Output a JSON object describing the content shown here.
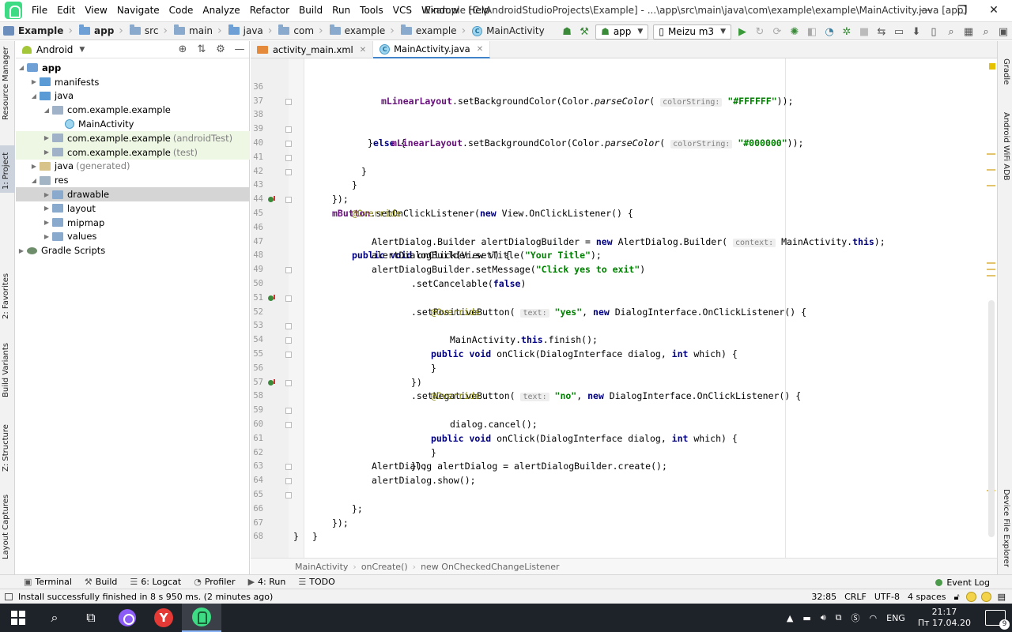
{
  "window": {
    "title": "Example [C:\\AndroidStudioProjects\\Example] - ...\\app\\src\\main\\java\\com\\example\\example\\MainActivity.java [app]",
    "menu": [
      "File",
      "Edit",
      "View",
      "Navigate",
      "Code",
      "Analyze",
      "Refactor",
      "Build",
      "Run",
      "Tools",
      "VCS",
      "Window",
      "Help"
    ],
    "minimize": "—",
    "restore": "❐",
    "close": "✕"
  },
  "navbar": {
    "crumbs": [
      "Example",
      "app",
      "src",
      "main",
      "java",
      "com",
      "example",
      "example",
      "MainActivity"
    ],
    "run_config": "app",
    "device": "Meizu m3"
  },
  "left_tools": [
    "Resource Manager",
    "1: Project",
    "2: Favorites",
    "Build Variants",
    "Z: Structure",
    "Layout Captures"
  ],
  "right_tools": [
    "Gradle",
    "Android WiFi ADB",
    "Device File Explorer"
  ],
  "project_panel": {
    "view_mode": "Android",
    "tree": [
      {
        "label": "app",
        "muted": "",
        "depth": 0
      },
      {
        "label": "manifests",
        "muted": "",
        "depth": 1
      },
      {
        "label": "java",
        "muted": "",
        "depth": 1
      },
      {
        "label": "com.example.example",
        "muted": "",
        "depth": 2
      },
      {
        "label": "MainActivity",
        "muted": "",
        "depth": 3
      },
      {
        "label": "com.example.example",
        "muted": "(androidTest)",
        "depth": 2
      },
      {
        "label": "com.example.example",
        "muted": "(test)",
        "depth": 2
      },
      {
        "label": "java",
        "muted": "(generated)",
        "depth": 1
      },
      {
        "label": "res",
        "muted": "",
        "depth": 1
      },
      {
        "label": "drawable",
        "muted": "",
        "depth": 2
      },
      {
        "label": "layout",
        "muted": "",
        "depth": 2
      },
      {
        "label": "mipmap",
        "muted": "",
        "depth": 2
      },
      {
        "label": "values",
        "muted": "",
        "depth": 2
      },
      {
        "label": "Gradle Scripts",
        "muted": "",
        "depth": 0
      }
    ]
  },
  "editor": {
    "tabs": [
      {
        "label": "activity_main.xml",
        "active": false
      },
      {
        "label": "MainActivity.java",
        "active": true
      }
    ],
    "line_numbers": [
      "36",
      "37",
      "38",
      "39",
      "40",
      "41",
      "42",
      "43",
      "44",
      "45",
      "46",
      "47",
      "48",
      "49",
      "50",
      "51",
      "52",
      "53",
      "54",
      "55",
      "56",
      "57",
      "58",
      "59",
      "60",
      "61",
      "62",
      "63",
      "64",
      "65",
      "66",
      "67",
      "68"
    ],
    "code": {
      "l36_field": "mLinearLayout",
      "l36_a": ".setBackgroundColor(Color.",
      "l36_method": "parseColor",
      "l36_b": "( ",
      "l36_hint": "colorString:",
      "l36_str": "\"#FFFFFF\"",
      "l36_c": "));",
      "l38_a": "}",
      "l38_kw": "else",
      "l38_b": " {",
      "l39_field": "mLinearLayout",
      "l39_a": ".setBackgroundColor(Color.",
      "l39_method": "parseColor",
      "l39_b": "( ",
      "l39_hint": "colorString:",
      "l39_str": "\"#000000\"",
      "l39_c": "));",
      "l40": "}",
      "l41": "}",
      "l42": "});",
      "l43_field": "mButton",
      "l43_a": ".setOnClickListener(",
      "l43_kw": "new",
      "l43_b": " View.OnClickListener() {",
      "l44_ann": "@Override",
      "l45_kw1": "public",
      "l45_kw2": "void",
      "l45_a": " onClick(View v) {",
      "l46_a": "AlertDialog.Builder alertDialogBuilder = ",
      "l46_kw": "new",
      "l46_b": " AlertDialog.Builder( ",
      "l46_hint": "context:",
      "l46_c": " MainActivity.",
      "l46_kw2": "this",
      "l46_d": ");",
      "l47_a": "alertDialogBuilder.setTitle(",
      "l47_str": "\"Your Title\"",
      "l47_b": ");",
      "l48_a": "alertDialogBuilder.setMessage(",
      "l48_str": "\"Click yes to exit\"",
      "l48_b": ")",
      "l49_a": ".setCancelable(",
      "l49_kw": "false",
      "l49_b": ")",
      "l50_a": ".setPositiveButton( ",
      "l50_hint": "text:",
      "l50_str": "\"yes\"",
      "l50_b": ", ",
      "l50_kw": "new",
      "l50_c": " DialogInterface.OnClickListener() {",
      "l51_ann": "@Override",
      "l52_kw1": "public",
      "l52_kw2": "void",
      "l52_a": " onClick(DialogInterface dialog, ",
      "l52_kw3": "int",
      "l52_b": " which) {",
      "l53_a": "MainActivity.",
      "l53_kw": "this",
      "l53_b": ".finish();",
      "l54": "}",
      "l55": "})",
      "l56_a": ".setNegativeButton( ",
      "l56_hint": "text:",
      "l56_str": "\"no\"",
      "l56_b": ", ",
      "l56_kw": "new",
      "l56_c": " DialogInterface.OnClickListener() {",
      "l57_ann": "@Override",
      "l58_kw1": "public",
      "l58_kw2": "void",
      "l58_a": " onClick(DialogInterface dialog, ",
      "l58_kw3": "int",
      "l58_b": " which) {",
      "l59": "dialog.cancel();",
      "l60": "}",
      "l61": "});",
      "l62": "AlertDialog alertDialog = alertDialogBuilder.create();",
      "l63": "alertDialog.show();",
      "l64": "};",
      "l65": "});",
      "l66": "}",
      "l67": "}"
    },
    "breadcrumb": [
      "MainActivity",
      "onCreate()",
      "new OnCheckedChangeListener"
    ]
  },
  "bottom_tabs": [
    "Terminal",
    "Build",
    "6: Logcat",
    "Profiler",
    "4: Run",
    "TODO"
  ],
  "event_log": "Event Log",
  "status": {
    "message": "Install successfully finished in 8 s 950 ms. (2 minutes ago)",
    "position": "32:85",
    "line_sep": "CRLF",
    "encoding": "UTF-8",
    "indent": "4 spaces"
  },
  "taskbar": {
    "lang": "ENG",
    "time": "21:17",
    "date": "Пт 17.04.20",
    "notifications": "9",
    "yandex_letter": "Y"
  },
  "colors": {
    "keyword": "#000080",
    "field": "#660e7a",
    "string": "#008000",
    "annotation": "#808000"
  }
}
